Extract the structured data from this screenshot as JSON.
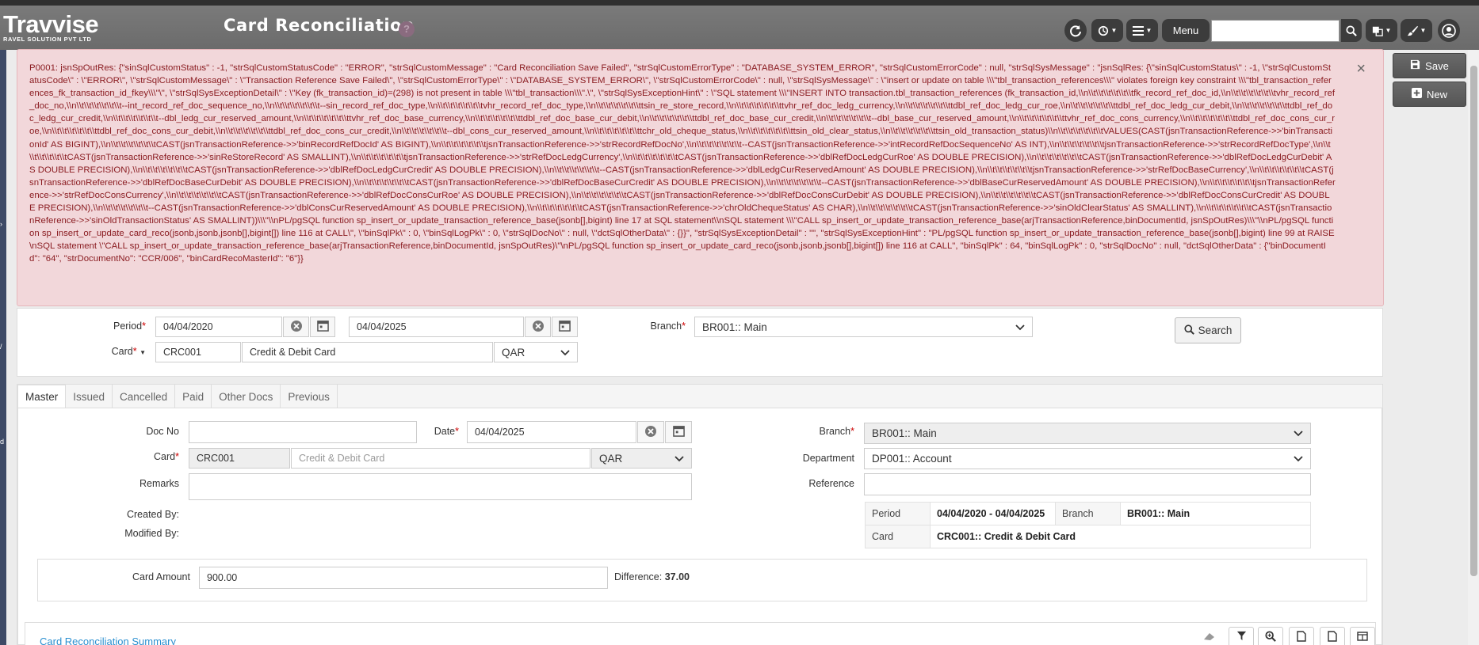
{
  "header": {
    "brand": "Travvise",
    "tagline": "RAVEL SOLUTION PVT LTD",
    "title": "Card Reconciliation",
    "help_icon": "?",
    "menu_label": "Menu",
    "icons": [
      "refresh-icon",
      "history-icon",
      "list-icon",
      "search-icon",
      "translate-icon",
      "brush-icon",
      "user-icon"
    ]
  },
  "alert": {
    "message": "P0001: jsnSpOutRes: {\"sinSqlCustomStatus\" : -1, \"strSqlCustomStatusCode\" : \"ERROR\", \"strSqlCustomMessage\" : \"Card Reconciliation Save Failed\", \"strSqlCustomErrorType\" : \"DATABASE_SYSTEM_ERROR\", \"strSqlCustomErrorCode\" : null, \"strSqlSysMessage\" : \"jsnSqlRes: {\\\"sinSqlCustomStatus\\\" : -1, \\\"strSqlCustomStatusCode\\\" : \\\"ERROR\\\", \\\"strSqlCustomMessage\\\" : \\\"Transaction Reference Save Failed\\\", \\\"strSqlCustomErrorType\\\" : \\\"DATABASE_SYSTEM_ERROR\\\", \\\"strSqlCustomErrorCode\\\" : null, \\\"strSqlSysMessage\\\" : \\\"insert or update on table \\\\\\\"tbl_transaction_references\\\\\\\" violates foreign key constraint \\\\\\\"tbl_transaction_references_fk_transaction_id_fkey\\\\\\\"\\\", \\\"strSqlSysExceptionDetail\\\" : \\\"Key (fk_transaction_id)=(298) is not present in table \\\\\\\"tbl_transaction\\\\\\\".\\\", \\\"strSqlSysExceptionHint\\\" : \\\"SQL statement \\\\\\\"INSERT INTO transaction.tbl_transaction_references (fk_transaction_id,\\\\n\\\\t\\\\t\\\\t\\\\t\\\\t\\\\tfk_record_ref_doc_id,\\\\n\\\\t\\\\t\\\\t\\\\t\\\\t\\\\tvhr_record_ref_doc_no,\\\\n\\\\t\\\\t\\\\t\\\\t\\\\t\\\\t--int_record_ref_doc_sequence_no,\\\\n\\\\t\\\\t\\\\t\\\\t\\\\t\\\\t--sin_record_ref_doc_type,\\\\n\\\\t\\\\t\\\\t\\\\t\\\\t\\\\tvhr_record_ref_doc_type,\\\\n\\\\t\\\\t\\\\t\\\\t\\\\t\\\\ttsin_re_store_record,\\\\n\\\\t\\\\t\\\\t\\\\t\\\\t\\\\ttvhr_ref_doc_ledg_currency,\\\\n\\\\t\\\\t\\\\t\\\\t\\\\t\\\\ttdbl_ref_doc_ledg_cur_roe,\\\\n\\\\t\\\\t\\\\t\\\\t\\\\t\\\\ttdbl_ref_doc_ledg_cur_debit,\\\\n\\\\t\\\\t\\\\t\\\\t\\\\t\\\\ttdbl_ref_doc_ledg_cur_credit,\\\\n\\\\t\\\\t\\\\t\\\\t\\\\t\\\\t--dbl_ledg_cur_reserved_amount,\\\\n\\\\t\\\\t\\\\t\\\\t\\\\t\\\\ttvhr_ref_doc_base_currency,\\\\n\\\\t\\\\t\\\\t\\\\t\\\\t\\\\ttdbl_ref_doc_base_cur_debit,\\\\n\\\\t\\\\t\\\\t\\\\t\\\\t\\\\ttdbl_ref_doc_base_cur_credit,\\\\n\\\\t\\\\t\\\\t\\\\t\\\\t\\\\t--dbl_base_cur_reserved_amount,\\\\n\\\\t\\\\t\\\\t\\\\t\\\\t\\\\ttvhr_ref_doc_cons_currency,\\\\n\\\\t\\\\t\\\\t\\\\t\\\\t\\\\ttdbl_ref_doc_cons_cur_roe,\\\\n\\\\t\\\\t\\\\t\\\\t\\\\t\\\\ttdbl_ref_doc_cons_cur_debit,\\\\n\\\\t\\\\t\\\\t\\\\t\\\\t\\\\ttdbl_ref_doc_cons_cur_credit,\\\\n\\\\t\\\\t\\\\t\\\\t\\\\t\\\\t--dbl_cons_cur_reserved_amount,\\\\n\\\\t\\\\t\\\\t\\\\t\\\\t\\\\ttchr_old_cheque_status,\\\\n\\\\t\\\\t\\\\t\\\\t\\\\t\\\\ttsin_old_clear_status,\\\\n\\\\t\\\\t\\\\t\\\\t\\\\t\\\\ttsin_old_transaction_status)\\\\n\\\\t\\\\t\\\\t\\\\t\\\\t\\\\tVALUES(CAST(jsnTransactionReference->>'binTransactionId' AS BIGINT),\\\\n\\\\t\\\\t\\\\t\\\\t\\\\t\\\\tCAST(jsnTransactionReference->>'binRecordRefDocId' AS BIGINT),\\\\n\\\\t\\\\t\\\\t\\\\t\\\\t\\\\tjsnTransactionReference->>'strRecordRefDocNo',\\\\n\\\\t\\\\t\\\\t\\\\t\\\\t\\\\t--CAST(jsnTransactionReference->>'intRecordRefDocSequenceNo' AS INT),\\\\n\\\\t\\\\t\\\\t\\\\t\\\\t\\\\tjsnTransactionReference->>'strRecordRefDocType',\\\\n\\\\t\\\\t\\\\t\\\\t\\\\t\\\\tCAST(jsnTransactionReference->>'sinReStoreRecord' AS SMALLINT),\\\\n\\\\t\\\\t\\\\t\\\\t\\\\t\\\\tjsnTransactionReference->>'strRefDocLedgCurrency',\\\\n\\\\t\\\\t\\\\t\\\\t\\\\t\\\\tCAST(jsnTransactionReference->>'dblRefDocLedgCurRoe' AS DOUBLE PRECISION),\\\\n\\\\t\\\\t\\\\t\\\\t\\\\t\\\\tCAST(jsnTransactionReference->>'dblRefDocLedgCurDebit' AS DOUBLE PRECISION),\\\\n\\\\t\\\\t\\\\t\\\\t\\\\t\\\\tCAST(jsnTransactionReference->>'dblRefDocLedgCurCredit' AS DOUBLE PRECISION),\\\\n\\\\t\\\\t\\\\t\\\\t\\\\t\\\\t--CAST(jsnTransactionReference->>'dblLedgCurReservedAmount' AS DOUBLE PRECISION),\\\\n\\\\t\\\\t\\\\t\\\\t\\\\t\\\\tjsnTransactionReference->>'strRefDocBaseCurrency',\\\\n\\\\t\\\\t\\\\t\\\\t\\\\t\\\\tCAST(jsnTransactionReference->>'dblRefDocBaseCurDebit' AS DOUBLE PRECISION),\\\\n\\\\t\\\\t\\\\t\\\\t\\\\t\\\\tCAST(jsnTransactionReference->>'dblRefDocBaseCurCredit' AS DOUBLE PRECISION),\\\\n\\\\t\\\\t\\\\t\\\\t\\\\t\\\\t--CAST(jsnTransactionReference->>'dblBaseCurReservedAmount' AS DOUBLE PRECISION),\\\\n\\\\t\\\\t\\\\t\\\\t\\\\t\\\\tjsnTransactionReference->>'strRefDocConsCurrency',\\\\n\\\\t\\\\t\\\\t\\\\t\\\\t\\\\tCAST(jsnTransactionReference->>'dblRefDocConsCurRoe' AS DOUBLE PRECISION),\\\\n\\\\t\\\\t\\\\t\\\\t\\\\t\\\\tCAST(jsnTransactionReference->>'dblRefDocConsCurDebit' AS DOUBLE PRECISION),\\\\n\\\\t\\\\t\\\\t\\\\t\\\\t\\\\tCAST(jsnTransactionReference->>'dblRefDocConsCurCredit' AS DOUBLE PRECISION),\\\\n\\\\t\\\\t\\\\t\\\\t\\\\t\\\\t--CAST(jsnTransactionReference->>'dblConsCurReservedAmount' AS DOUBLE PRECISION),\\\\n\\\\t\\\\t\\\\t\\\\t\\\\t\\\\tCAST(jsnTransactionReference->>'chrOldChequeStatus' AS CHAR),\\\\n\\\\t\\\\t\\\\t\\\\t\\\\t\\\\tCAST(jsnTransactionReference->>'sinOldClearStatus' AS SMALLINT),\\\\n\\\\t\\\\t\\\\t\\\\t\\\\t\\\\tCAST(jsnTransactionReference->>'sinOldTransactionStatus' AS SMALLINT))\\\\\\\"\\\\nPL/pgSQL function sp_insert_or_update_transaction_reference_base(jsonb[],bigint) line 17 at SQL statement\\\\nSQL statement \\\\\\\"CALL sp_insert_or_update_transaction_reference_base(arjTransactionReference,binDocumentId, jsnSpOutRes)\\\\\\\"\\\\nPL/pgSQL function sp_insert_or_update_card_reco(jsonb,jsonb,jsonb[],bigint[]) line 116 at CALL\\\", \\\"binSqlPk\\\" : 0, \\\"binSqlLogPk\\\" : 0, \\\"strSqlDocNo\\\" : null, \\\"dctSqlOtherData\\\" : {}}\", \"strSqlSysExceptionDetail\" : \"\", \"strSqlSysExceptionHint\" : \"PL/pgSQL function sp_insert_or_update_transaction_reference_base(jsonb[],bigint) line 99 at RAISE\\nSQL statement \\\"CALL sp_insert_or_update_transaction_reference_base(arjTransactionReference,binDocumentId, jsnSpOutRes)\\\"\\nPL/pgSQL function sp_insert_or_update_card_reco(jsonb,jsonb,jsonb[],bigint[]) line 116 at CALL\", \"binSqlPk\" : 64, \"binSqlLogPk\" : 0, \"strSqlDocNo\" : null, \"dctSqlOtherData\" : {\"binDocumentId\": \"64\", \"strDocumentNo\": \"CCR/006\", \"binCardRecoMasterId\": \"6\"}}",
    "close": "×"
  },
  "actions": {
    "save": "Save",
    "new": "New"
  },
  "filter": {
    "period_label": "Period",
    "period_from": "04/04/2020",
    "period_to": "04/04/2025",
    "card_label": "Card",
    "card_code": "CRC001",
    "card_name": "Credit & Debit Card",
    "currency": "QAR",
    "branch_label": "Branch",
    "branch": "BR001:: Main",
    "search_label": "Search"
  },
  "tabs": [
    "Master",
    "Issued",
    "Cancelled",
    "Paid",
    "Other Docs",
    "Previous"
  ],
  "master": {
    "doc_no_label": "Doc No",
    "doc_no": "",
    "date_label": "Date",
    "date": "04/04/2025",
    "card_label": "Card",
    "card_code": "CRC001",
    "card_name_placeholder": "Credit & Debit Card",
    "currency": "QAR",
    "remarks_label": "Remarks",
    "created_by_label": "Created By:",
    "modified_by_label": "Modified By:",
    "branch_label": "Branch",
    "branch": "BR001:: Main",
    "department_label": "Department",
    "department": "DP001:: Account",
    "reference_label": "Reference",
    "info": {
      "period_label": "Period",
      "period": "04/04/2020 - 04/04/2025",
      "branch_label": "Branch",
      "branch": "BR001:: Main",
      "card_label": "Card",
      "card": "CRC001:: Credit & Debit Card"
    },
    "card_amount_label": "Card Amount",
    "card_amount": "900.00",
    "difference_label": "Difference:",
    "difference": "37.00"
  },
  "summary": {
    "title": "Card Reconciliation Summary"
  },
  "colors": {
    "alert_bg": "#f2d7da",
    "alert_text": "#8b1d22",
    "header_bg": "#707070",
    "link": "#2a8fd0",
    "required": "#cc0000"
  }
}
